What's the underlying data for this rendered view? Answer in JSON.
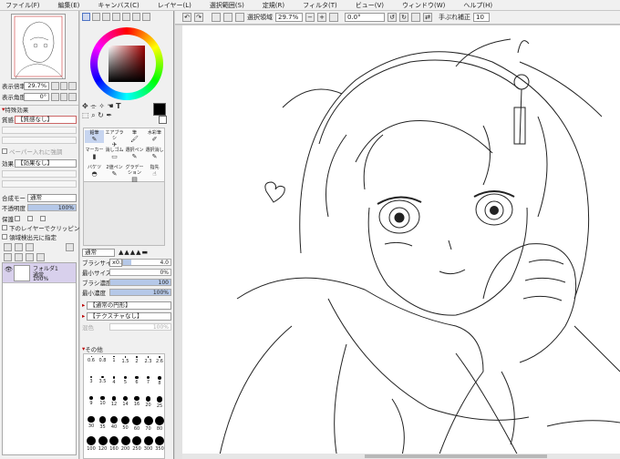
{
  "menu": [
    "ファイル(F)",
    "編集(E)",
    "キャンバス(C)",
    "レイヤー(L)",
    "選択範囲(S)",
    "定規(R)",
    "フィルタ(T)",
    "ビュー(V)",
    "ウィンドウ(W)",
    "ヘルプ(H)"
  ],
  "navigator": {
    "zoom_label": "表示倍率",
    "zoom_value": "29.7%",
    "angle_label": "表示角度",
    "angle_value": "0°"
  },
  "layer_props": {
    "section": "特殊効果",
    "texture_label": "質感",
    "texture_value": "【質感なし】",
    "mask_value": "",
    "clip_label": "ペーパー入れに強調",
    "effect_label": "効果",
    "effect_value": "【効果なし】",
    "blend_label": "合成モード",
    "blend_value": "通常",
    "opacity_label": "不透明度",
    "opacity_value": "100%",
    "opacity": 1.0,
    "protect_label": "保護",
    "clip_lower": "下のレイヤーでクリッピング",
    "sel_source": "領域検出元に指定"
  },
  "layer": {
    "name": "フォルダ1",
    "mode": "通常",
    "opacity": "100%"
  },
  "canvas_toolbar": {
    "selection_label": "選択領域",
    "zoom_value": "29.7%",
    "angle_value": "0.0°",
    "stabilizer_label": "手ぶれ補正",
    "stabilizer_value": "10"
  },
  "tools": [
    {
      "name": "鉛筆",
      "icon": "✎"
    },
    {
      "name": "エアブラシ",
      "icon": "✈"
    },
    {
      "name": "筆",
      "icon": "🖌"
    },
    {
      "name": "水彩筆",
      "icon": "✐"
    },
    {
      "name": "マーカー",
      "icon": "▮"
    },
    {
      "name": "消しゴム",
      "icon": "▭"
    },
    {
      "name": "選択ペン",
      "icon": "✎"
    },
    {
      "name": "選択消し",
      "icon": "✎"
    },
    {
      "name": "バケツ",
      "icon": "◓"
    },
    {
      "name": "2値ペン",
      "icon": "✎"
    },
    {
      "name": "グラデーション",
      "icon": "▤"
    },
    {
      "name": "指先",
      "icon": "☝"
    }
  ],
  "brush": {
    "mode_value": "通常",
    "size_label": "ブラシサイズ",
    "size_mult": "x0.1",
    "size_value": "4.0",
    "size_level": 0.18,
    "min_size_label": "最小サイズ",
    "min_size_value": "0%",
    "min_size_level": 0.0,
    "density_label": "ブラシ濃度",
    "density_value": "100",
    "density_level": 1.0,
    "min_density_label": "最小濃度",
    "min_density_value": "100%",
    "min_density_level": 1.0,
    "shape_value": "【通常の円形】",
    "texture_value": "【テクスチャなし】",
    "blend_label": "混色",
    "blend_value": "100%",
    "other_section": "その他"
  },
  "dot_sizes": [
    "0.6",
    "0.8",
    "1",
    "1.5",
    "2",
    "2.3",
    "2.6",
    "3",
    "3.5",
    "4",
    "5",
    "6",
    "7",
    "8",
    "9",
    "10",
    "12",
    "14",
    "16",
    "20",
    "25",
    "30",
    "35",
    "40",
    "50",
    "60",
    "70",
    "80",
    "100",
    "120",
    "160",
    "200",
    "250",
    "300",
    "350"
  ],
  "colors": {
    "accent": "#4e74c4",
    "hue_marker": "#a40000"
  }
}
